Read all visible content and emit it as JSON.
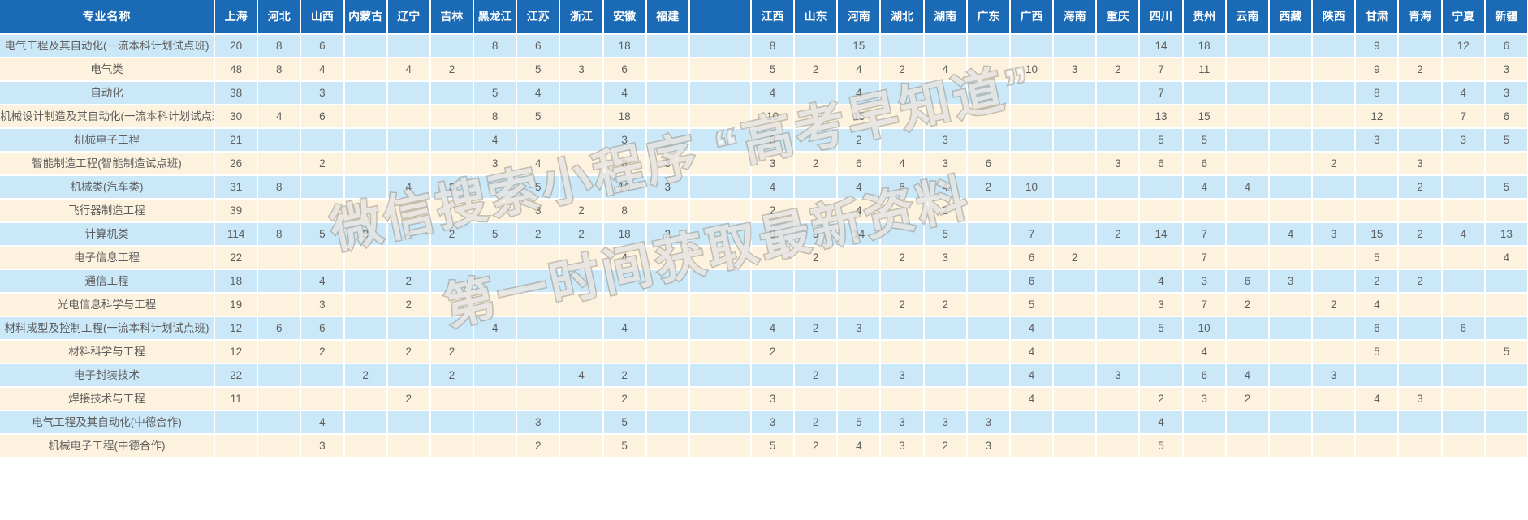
{
  "table": {
    "first_column_header": "专业名称",
    "province_headers": [
      "上海",
      "河北",
      "山西",
      "内蒙古",
      "辽宁",
      "吉林",
      "黑龙江",
      "江苏",
      "浙江",
      "安徽",
      "福建",
      "",
      "江西",
      "山东",
      "河南",
      "湖北",
      "湖南",
      "广东",
      "广西",
      "海南",
      "重庆",
      "四川",
      "贵州",
      "云南",
      "西藏",
      "陕西",
      "甘肃",
      "青海",
      "宁夏",
      "新疆"
    ],
    "rows": [
      {
        "name": "电气工程及其自动化(一流本科计划试点班)",
        "values": [
          "20",
          "8",
          "6",
          "",
          "",
          "",
          "8",
          "6",
          "",
          "18",
          "",
          "",
          "8",
          "",
          "15",
          "",
          "",
          "",
          "",
          "",
          "",
          "14",
          "18",
          "",
          "",
          "",
          "9",
          "",
          "12",
          "6"
        ]
      },
      {
        "name": "电气类",
        "values": [
          "48",
          "8",
          "4",
          "",
          "4",
          "2",
          "",
          "5",
          "3",
          "6",
          "",
          "",
          "5",
          "2",
          "4",
          "2",
          "4",
          "",
          "10",
          "3",
          "2",
          "7",
          "11",
          "",
          "",
          "",
          "9",
          "2",
          "",
          "3"
        ]
      },
      {
        "name": "自动化",
        "values": [
          "38",
          "",
          "3",
          "",
          "",
          "",
          "5",
          "4",
          "",
          "4",
          "",
          "",
          "4",
          "",
          "4",
          "",
          "",
          "",
          "",
          "",
          "",
          "7",
          "",
          "",
          "",
          "",
          "8",
          "",
          "4",
          "3"
        ]
      },
      {
        "name": "机械设计制造及其自动化(一流本科计划试点班)",
        "values": [
          "30",
          "4",
          "6",
          "",
          "",
          "",
          "8",
          "5",
          "",
          "18",
          "",
          "",
          "10",
          "",
          "15",
          "",
          "",
          "",
          "",
          "",
          "",
          "13",
          "15",
          "",
          "",
          "",
          "12",
          "",
          "7",
          "6"
        ]
      },
      {
        "name": "机械电子工程",
        "values": [
          "21",
          "",
          "",
          "",
          "",
          "",
          "4",
          "",
          "",
          "3",
          "",
          "",
          "3",
          "",
          "2",
          "",
          "3",
          "",
          "",
          "",
          "",
          "5",
          "5",
          "",
          "",
          "",
          "3",
          "",
          "3",
          "5"
        ]
      },
      {
        "name": "智能制造工程(智能制造试点班)",
        "values": [
          "26",
          "",
          "2",
          "",
          "",
          "",
          "3",
          "4",
          "",
          "8",
          "3",
          "",
          "3",
          "2",
          "6",
          "4",
          "3",
          "6",
          "",
          "",
          "3",
          "6",
          "6",
          "",
          "",
          "2",
          "",
          "3",
          "",
          ""
        ]
      },
      {
        "name": "机械类(汽车类)",
        "values": [
          "31",
          "8",
          "",
          "",
          "4",
          "3",
          "",
          "5",
          "",
          "10",
          "3",
          "",
          "4",
          "",
          "4",
          "6",
          "4",
          "2",
          "10",
          "",
          "",
          "",
          "4",
          "4",
          "",
          "",
          "",
          "2",
          "",
          "5"
        ]
      },
      {
        "name": "飞行器制造工程",
        "values": [
          "39",
          "",
          "",
          "",
          "",
          "",
          "",
          "3",
          "2",
          "8",
          "",
          "",
          "2",
          "",
          "4",
          "",
          "2",
          "",
          "",
          "",
          "",
          "",
          "",
          "",
          "",
          "",
          "",
          "",
          "",
          ""
        ]
      },
      {
        "name": "计算机类",
        "values": [
          "114",
          "8",
          "5",
          "3",
          "4",
          "2",
          "5",
          "2",
          "2",
          "18",
          "2",
          "",
          "9",
          "3",
          "14",
          "",
          "5",
          "",
          "7",
          "",
          "2",
          "14",
          "7",
          "",
          "4",
          "3",
          "15",
          "2",
          "4",
          "13"
        ]
      },
      {
        "name": "电子信息工程",
        "values": [
          "22",
          "",
          "",
          "",
          "",
          "",
          "",
          "",
          "",
          "4",
          "",
          "",
          "",
          "2",
          "",
          "2",
          "3",
          "",
          "6",
          "2",
          "",
          "",
          "7",
          "",
          "",
          "",
          "5",
          "",
          "",
          "4"
        ]
      },
      {
        "name": "通信工程",
        "values": [
          "18",
          "",
          "4",
          "",
          "2",
          "",
          "",
          "",
          "",
          "",
          "",
          "",
          "",
          "",
          "",
          "",
          "",
          "",
          "6",
          "",
          "",
          "4",
          "3",
          "6",
          "3",
          "",
          "2",
          "2",
          "",
          ""
        ]
      },
      {
        "name": "光电信息科学与工程",
        "values": [
          "19",
          "",
          "3",
          "",
          "2",
          "",
          "",
          "",
          "",
          "",
          "",
          "",
          "",
          "",
          "",
          "2",
          "2",
          "",
          "5",
          "",
          "",
          "3",
          "7",
          "2",
          "",
          "2",
          "4",
          "",
          "",
          ""
        ]
      },
      {
        "name": "材料成型及控制工程(一流本科计划试点班)",
        "values": [
          "12",
          "6",
          "6",
          "",
          "",
          "",
          "4",
          "",
          "",
          "4",
          "",
          "",
          "4",
          "2",
          "3",
          "",
          "",
          "",
          "4",
          "",
          "",
          "5",
          "10",
          "",
          "",
          "",
          "6",
          "",
          "6",
          ""
        ]
      },
      {
        "name": "材料科学与工程",
        "values": [
          "12",
          "",
          "2",
          "",
          "2",
          "2",
          "",
          "",
          "",
          "",
          "",
          "",
          "2",
          "",
          "",
          "",
          "",
          "",
          "4",
          "",
          "",
          "",
          "4",
          "",
          "",
          "",
          "5",
          "",
          "",
          "5"
        ]
      },
      {
        "name": "电子封装技术",
        "values": [
          "22",
          "",
          "",
          "2",
          "",
          "2",
          "",
          "",
          "4",
          "2",
          "",
          "",
          "",
          "2",
          "",
          "3",
          "",
          "",
          "4",
          "",
          "3",
          "",
          "6",
          "4",
          "",
          "3",
          "",
          "",
          "",
          ""
        ]
      },
      {
        "name": "焊接技术与工程",
        "values": [
          "11",
          "",
          "",
          "",
          "2",
          "",
          "",
          "",
          "",
          "2",
          "",
          "",
          "3",
          "",
          "",
          "",
          "",
          "",
          "4",
          "",
          "",
          "2",
          "3",
          "2",
          "",
          "",
          "4",
          "3",
          "",
          ""
        ]
      },
      {
        "name": "电气工程及其自动化(中德合作)",
        "values": [
          "",
          "",
          "4",
          "",
          "",
          "",
          "",
          "3",
          "",
          "5",
          "",
          "",
          "3",
          "2",
          "5",
          "3",
          "3",
          "3",
          "",
          "",
          "",
          "4",
          "",
          "",
          "",
          "",
          "",
          "",
          "",
          ""
        ]
      },
      {
        "name": "机械电子工程(中德合作)",
        "values": [
          "",
          "",
          "3",
          "",
          "",
          "",
          "",
          "2",
          "",
          "5",
          "",
          "",
          "5",
          "2",
          "4",
          "3",
          "2",
          "3",
          "",
          "",
          "",
          "5",
          "",
          "",
          "",
          "",
          "",
          "",
          "",
          ""
        ]
      }
    ]
  },
  "watermark": {
    "line1": "微信搜索小程序 “高考早知道”",
    "line2": "第一时间获取最新资料"
  },
  "colors": {
    "header_blue": "#1a6ab5",
    "row_odd": "#cbe8f9",
    "row_even": "#fdf2dd",
    "text_gray": "#5e5e5e"
  }
}
